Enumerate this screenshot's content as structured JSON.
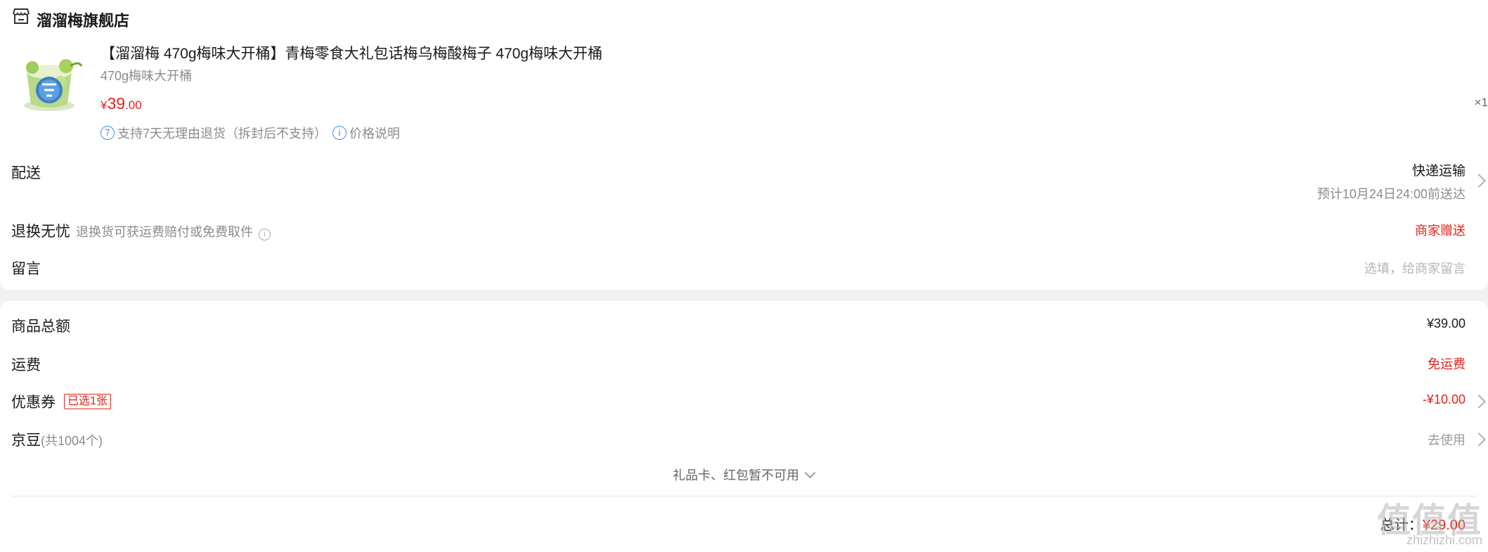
{
  "store": {
    "name": "溜溜梅旗舰店",
    "icon": "store-icon"
  },
  "product": {
    "title": "【溜溜梅 470g梅味大开桶】青梅零食大礼包话梅乌梅酸梅子 470g梅味大开桶",
    "spec": "470g梅味大开桶",
    "price_currency": "¥",
    "price_int": "39",
    "price_dec": ".00",
    "quantity": "×1",
    "service_return": "支持7天无理由退货（拆封后不支持）",
    "service_return_icon_text": "7",
    "service_price": "价格说明",
    "service_price_icon_text": "i"
  },
  "delivery": {
    "label": "配送",
    "method": "快递运输",
    "eta": "预计10月24日24:00前送达"
  },
  "worry_free": {
    "label": "退换无忧",
    "desc": "退换货可获运费赔付或免费取件",
    "value": "商家赠送"
  },
  "message": {
    "label": "留言",
    "placeholder": "选填，给商家留言"
  },
  "summary": {
    "goods_total_label": "商品总额",
    "goods_total_value": "¥39.00",
    "shipping_label": "运费",
    "shipping_value": "免运费",
    "coupon_label": "优惠券",
    "coupon_badge": "已选1张",
    "coupon_value": "-¥10.00",
    "jingdou_label": "京豆",
    "jingdou_count": "(共1004个)",
    "jingdou_action": "去使用",
    "giftcard_note": "礼品卡、红包暂不可用",
    "total_label": "总计：",
    "total_value": "¥29.00"
  },
  "watermark": {
    "main": "值值值",
    "sub": "zhizhizhi.com"
  },
  "colors": {
    "accent": "#e2231a",
    "info_blue": "#4a8fdc"
  }
}
